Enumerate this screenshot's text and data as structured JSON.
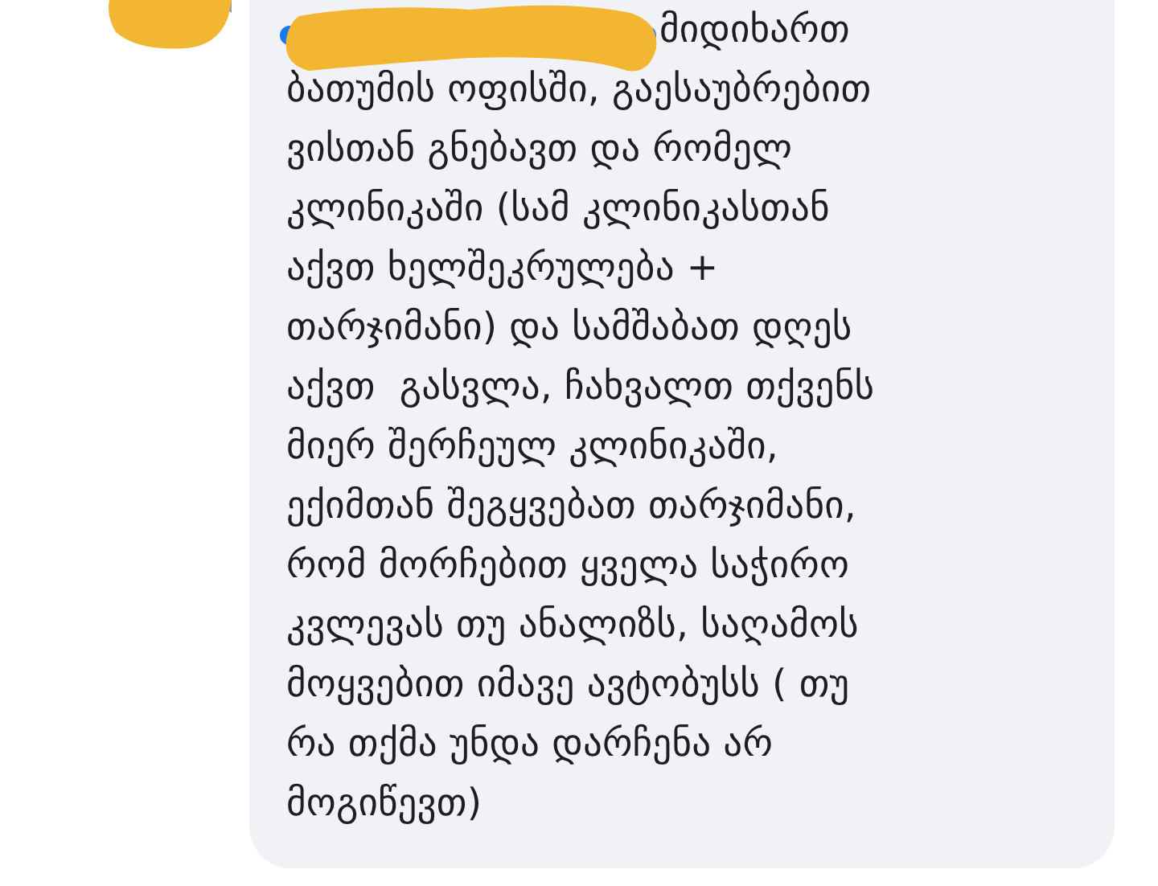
{
  "comment": {
    "author_redacted": true,
    "lines": [
      "მიდიხართ",
      "ბათუმის ოფისში, გაესაუბრებით",
      "ვისთან გნებავთ და რომელ",
      "კლინიკაში (სამ კლინიკასთან",
      "აქვთ ხელშეკრულება +",
      "თარჯიმანი) და სამშაბათ დღეს",
      "აქვთ  გასვლა, ჩახვალთ თქვენს",
      "მიერ შერჩეულ კლინიკაში,",
      "ექიმთან შეგყვებათ თარჯიმანი,",
      "რომ მორჩებით ყველა საჭირო",
      "კვლევას თუ ანალიზს, საღამოს",
      "მოყვებით იმავე ავტობუსს ( თუ",
      "რა თქმა უნდა დარჩენა არ",
      "მოგიწევთ)"
    ]
  }
}
